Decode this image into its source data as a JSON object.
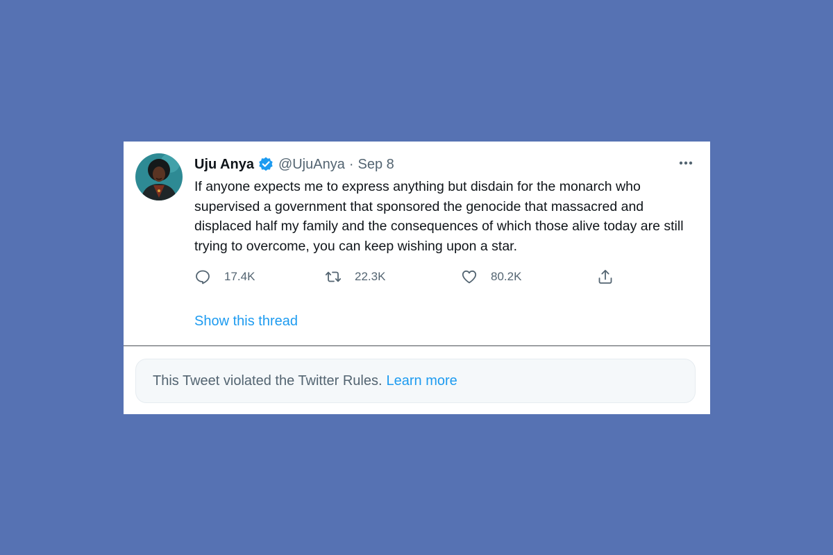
{
  "tweet": {
    "author_name": "Uju Anya",
    "handle": "@UjuAnya",
    "separator": "·",
    "date": "Sep 8",
    "text": "If anyone expects me to express anything but disdain for the monarch who supervised a government that sponsored the genocide that massacred and displaced half my family and the consequences of which those alive today are still trying to overcome, you can keep wishing upon a star.",
    "verified": true,
    "actions": {
      "replies": "17.4K",
      "retweets": "22.3K",
      "likes": "80.2K"
    },
    "show_thread_label": "Show this thread"
  },
  "notice": {
    "text": "This Tweet violated the Twitter Rules.",
    "link_label": "Learn more"
  },
  "colors": {
    "page_background": "#5672b3",
    "card_background": "#ffffff",
    "accent": "#1d9bf0",
    "primary_text": "#0f1419",
    "secondary_text": "#536471",
    "notice_background": "#f5f8fa"
  },
  "icons": [
    "verified-badge-icon",
    "more-icon",
    "reply-icon",
    "retweet-icon",
    "like-icon",
    "share-icon"
  ]
}
